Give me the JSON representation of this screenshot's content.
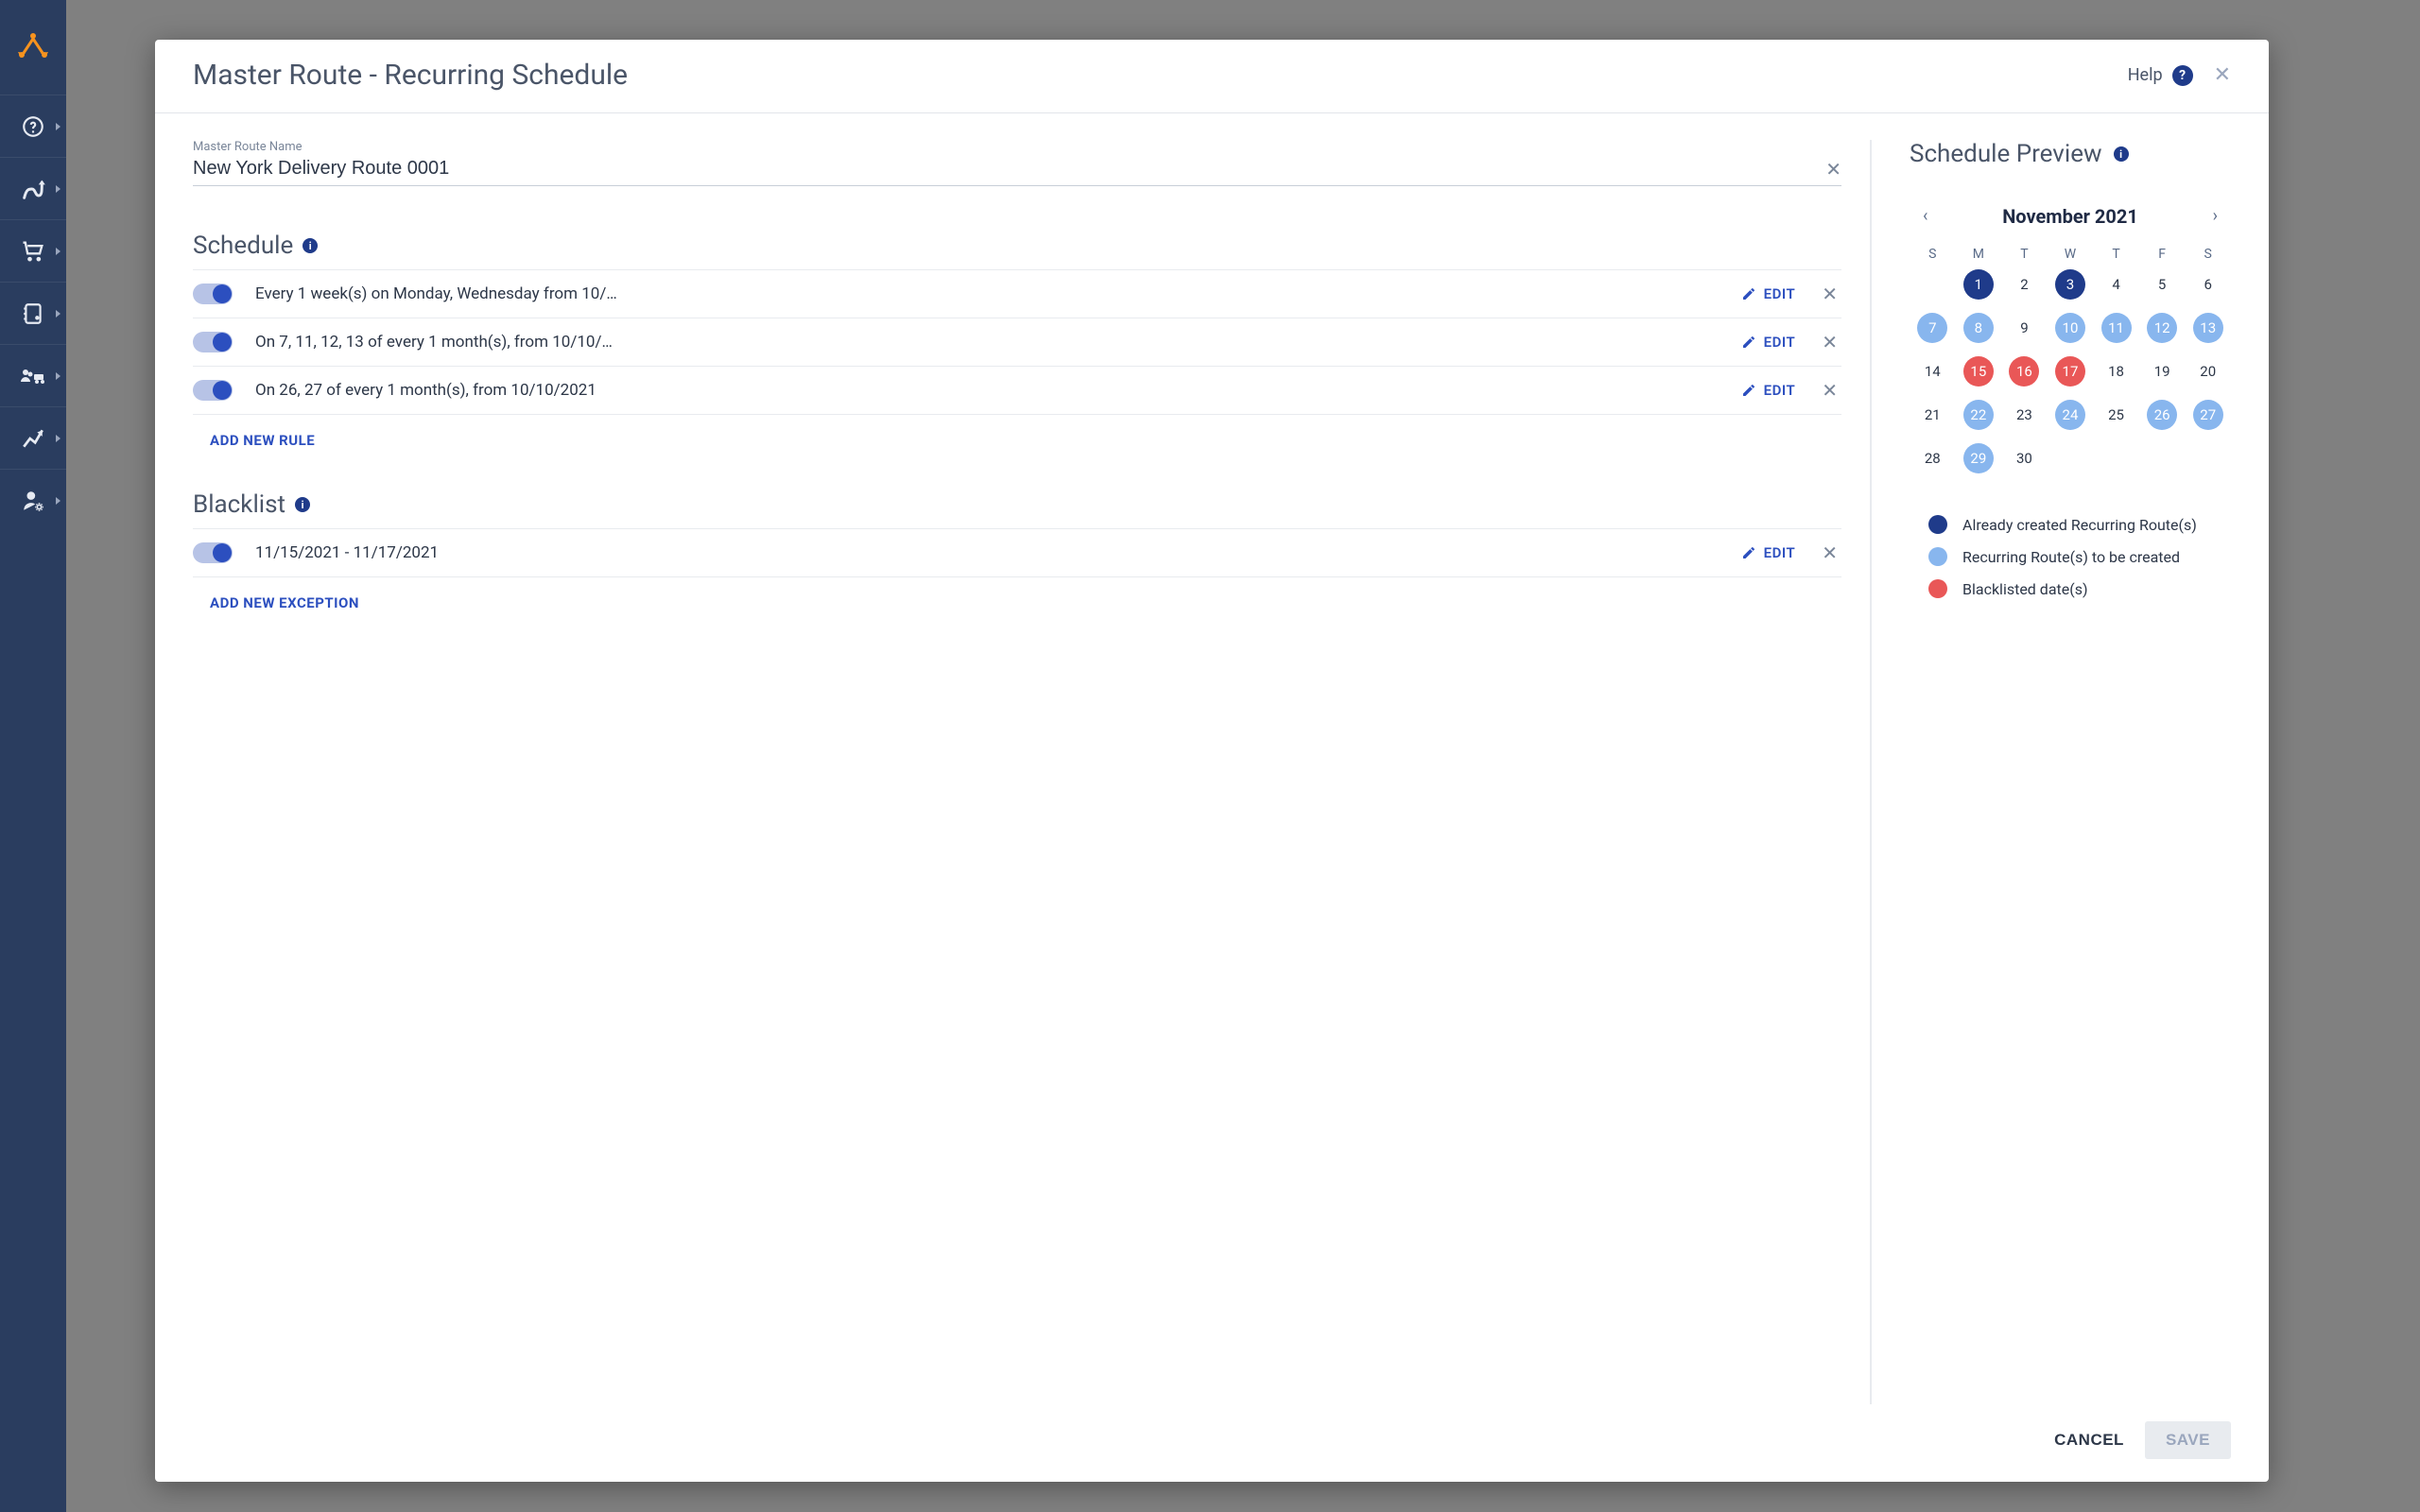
{
  "modal": {
    "title": "Master Route - Recurring Schedule",
    "help_label": "Help",
    "field_label": "Master Route Name",
    "route_name": "New York Delivery Route 0001",
    "schedule_title": "Schedule",
    "blacklist_title": "Blacklist",
    "add_rule_label": "ADD NEW RULE",
    "add_exception_label": "ADD NEW EXCEPTION",
    "edit_label": "EDIT",
    "cancel_label": "CANCEL",
    "save_label": "SAVE"
  },
  "schedule_rules": [
    {
      "text": "Every 1 week(s) on Monday, Wednesday from 10/…",
      "enabled": true
    },
    {
      "text": "On 7, 11, 12, 13 of every 1 month(s), from 10/10/…",
      "enabled": true
    },
    {
      "text": "On 26, 27 of every 1 month(s), from 10/10/2021",
      "enabled": true
    }
  ],
  "blacklist_rules": [
    {
      "text": "11/15/2021 - 11/17/2021",
      "enabled": true
    }
  ],
  "preview": {
    "title": "Schedule Preview",
    "month_label": "November 2021",
    "dow": [
      "S",
      "M",
      "T",
      "W",
      "T",
      "F",
      "S"
    ],
    "days": [
      {
        "n": "",
        "cls": ""
      },
      {
        "n": "1",
        "cls": "created"
      },
      {
        "n": "2",
        "cls": ""
      },
      {
        "n": "3",
        "cls": "created"
      },
      {
        "n": "4",
        "cls": ""
      },
      {
        "n": "5",
        "cls": ""
      },
      {
        "n": "6",
        "cls": ""
      },
      {
        "n": "7",
        "cls": "tobe"
      },
      {
        "n": "8",
        "cls": "tobe"
      },
      {
        "n": "9",
        "cls": ""
      },
      {
        "n": "10",
        "cls": "tobe"
      },
      {
        "n": "11",
        "cls": "tobe"
      },
      {
        "n": "12",
        "cls": "tobe"
      },
      {
        "n": "13",
        "cls": "tobe"
      },
      {
        "n": "14",
        "cls": ""
      },
      {
        "n": "15",
        "cls": "black"
      },
      {
        "n": "16",
        "cls": "black"
      },
      {
        "n": "17",
        "cls": "black"
      },
      {
        "n": "18",
        "cls": ""
      },
      {
        "n": "19",
        "cls": ""
      },
      {
        "n": "20",
        "cls": ""
      },
      {
        "n": "21",
        "cls": ""
      },
      {
        "n": "22",
        "cls": "tobe"
      },
      {
        "n": "23",
        "cls": ""
      },
      {
        "n": "24",
        "cls": "tobe"
      },
      {
        "n": "25",
        "cls": ""
      },
      {
        "n": "26",
        "cls": "tobe"
      },
      {
        "n": "27",
        "cls": "tobe"
      },
      {
        "n": "28",
        "cls": ""
      },
      {
        "n": "29",
        "cls": "tobe"
      },
      {
        "n": "30",
        "cls": ""
      },
      {
        "n": "",
        "cls": ""
      },
      {
        "n": "",
        "cls": ""
      },
      {
        "n": "",
        "cls": ""
      },
      {
        "n": "",
        "cls": ""
      }
    ],
    "legend": {
      "created": "Already created Recurring Route(s)",
      "tobe": "Recurring Route(s) to be created",
      "black": "Blacklisted date(s)"
    }
  },
  "sidebar": {
    "items": [
      {
        "name": "nav-help"
      },
      {
        "name": "nav-routes"
      },
      {
        "name": "nav-orders"
      },
      {
        "name": "nav-addressbook"
      },
      {
        "name": "nav-team"
      },
      {
        "name": "nav-analytics"
      },
      {
        "name": "nav-settings"
      }
    ]
  }
}
